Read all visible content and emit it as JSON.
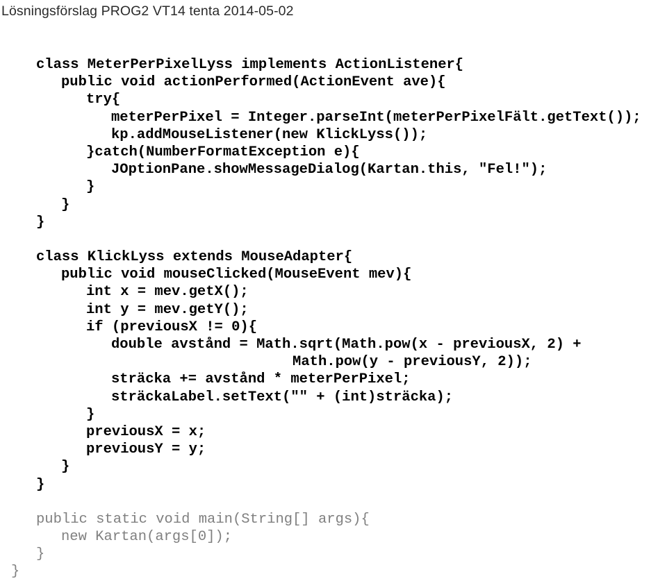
{
  "document": {
    "title": "Lösningsförslag PROG2 VT14 tenta 2014-05-02",
    "language": "java",
    "colors": {
      "page_background": "#ffffff",
      "header_text": "#2b2b2b",
      "code_primary": "#000000",
      "code_secondary": "#808080"
    }
  },
  "code": {
    "indent_unit_spaces": 4,
    "lines": [
      {
        "indent": 0,
        "text": "class MeterPerPixelLyss implements ActionListener{",
        "tier": "primary"
      },
      {
        "indent": 1,
        "text": "public void actionPerformed(ActionEvent ave){",
        "tier": "primary"
      },
      {
        "indent": 2,
        "text": "try{",
        "tier": "primary"
      },
      {
        "indent": 3,
        "text": "meterPerPixel = Integer.parseInt(meterPerPixelFält.getText());",
        "tier": "primary"
      },
      {
        "indent": 3,
        "text": "kp.addMouseListener(new KlickLyss());",
        "tier": "primary"
      },
      {
        "indent": 2,
        "text": "}catch(NumberFormatException e){",
        "tier": "primary"
      },
      {
        "indent": 3,
        "text": "JOptionPane.showMessageDialog(Kartan.this, \"Fel!\");",
        "tier": "primary"
      },
      {
        "indent": 2,
        "text": "}",
        "tier": "primary"
      },
      {
        "indent": 1,
        "text": "}",
        "tier": "primary"
      },
      {
        "indent": 0,
        "text": "}",
        "tier": "primary"
      },
      {
        "indent": 0,
        "text": "",
        "tier": "primary"
      },
      {
        "indent": 0,
        "text": "class KlickLyss extends MouseAdapter{",
        "tier": "primary"
      },
      {
        "indent": 1,
        "text": "public void mouseClicked(MouseEvent mev){",
        "tier": "primary"
      },
      {
        "indent": 2,
        "text": "int x = mev.getX();",
        "tier": "primary"
      },
      {
        "indent": 2,
        "text": "int y = mev.getY();",
        "tier": "primary"
      },
      {
        "indent": 2,
        "text": "if (previousX != 0){",
        "tier": "primary"
      },
      {
        "indent": 3,
        "text": "double avstånd = Math.sqrt(Math.pow(x - previousX, 2) +",
        "tier": "primary"
      },
      {
        "indent": 0,
        "text": "                              Math.pow(y - previousY, 2));",
        "tier": "primary",
        "raw": true
      },
      {
        "indent": 3,
        "text": "sträcka += avstånd * meterPerPixel;",
        "tier": "primary"
      },
      {
        "indent": 3,
        "text": "sträckaLabel.setText(\"\" + (int)sträcka);",
        "tier": "primary"
      },
      {
        "indent": 2,
        "text": "}",
        "tier": "primary"
      },
      {
        "indent": 2,
        "text": "previousX = x;",
        "tier": "primary"
      },
      {
        "indent": 2,
        "text": "previousY = y;",
        "tier": "primary"
      },
      {
        "indent": 1,
        "text": "}",
        "tier": "primary"
      },
      {
        "indent": 0,
        "text": "}",
        "tier": "primary"
      },
      {
        "indent": 0,
        "text": "",
        "tier": "primary"
      },
      {
        "indent": 0,
        "text": "public static void main(String[] args){",
        "tier": "secondary"
      },
      {
        "indent": 1,
        "text": "new Kartan(args[0]);",
        "tier": "secondary"
      },
      {
        "indent": 0,
        "text": "}",
        "tier": "secondary"
      }
    ],
    "closing_brace": {
      "indent": -1,
      "text": "}",
      "tier": "secondary"
    }
  }
}
